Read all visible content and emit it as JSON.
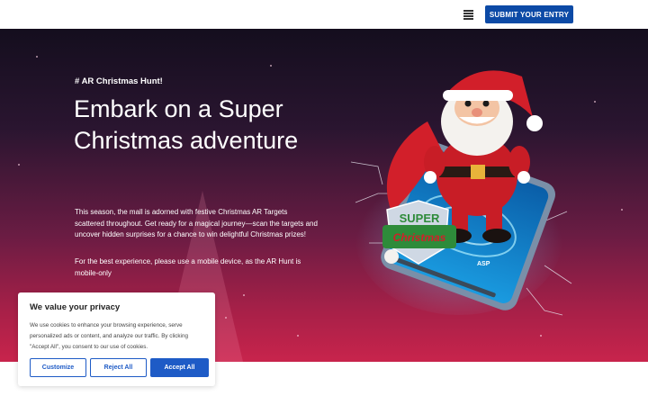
{
  "header": {
    "menu_icon": "hamburger-menu-icon",
    "submit_label": "SUBMIT YOUR ENTRY"
  },
  "hero": {
    "eyebrow": "# AR Christmas Hunt!",
    "headline": "Embark on a Super Christmas adventure",
    "description": "This season, the mall is adorned with festive Christmas AR Targets scattered throughout. Get ready for a magical journey—scan the targets and uncover hidden surprises for a chance to win delightful Christmas prizes!",
    "note": "For the best experience, please use a mobile device, as the AR Hunt is mobile-only",
    "illustration": {
      "badge_line1": "SUPER",
      "badge_line2": "Christmas",
      "phone_logo": "ASP"
    }
  },
  "cookie_banner": {
    "title": "We value your privacy",
    "text": "We use cookies to enhance your browsing experience, serve personalized ads or content, and analyze our traffic. By clicking \"Accept All\", you consent to our use of cookies.",
    "customize_label": "Customize",
    "reject_label": "Reject All",
    "accept_label": "Accept All"
  },
  "colors": {
    "brand_blue": "#0c4aa6",
    "cookie_blue": "#1e5bc6",
    "hero_dark": "#140e1e",
    "hero_red": "#c8244c"
  }
}
